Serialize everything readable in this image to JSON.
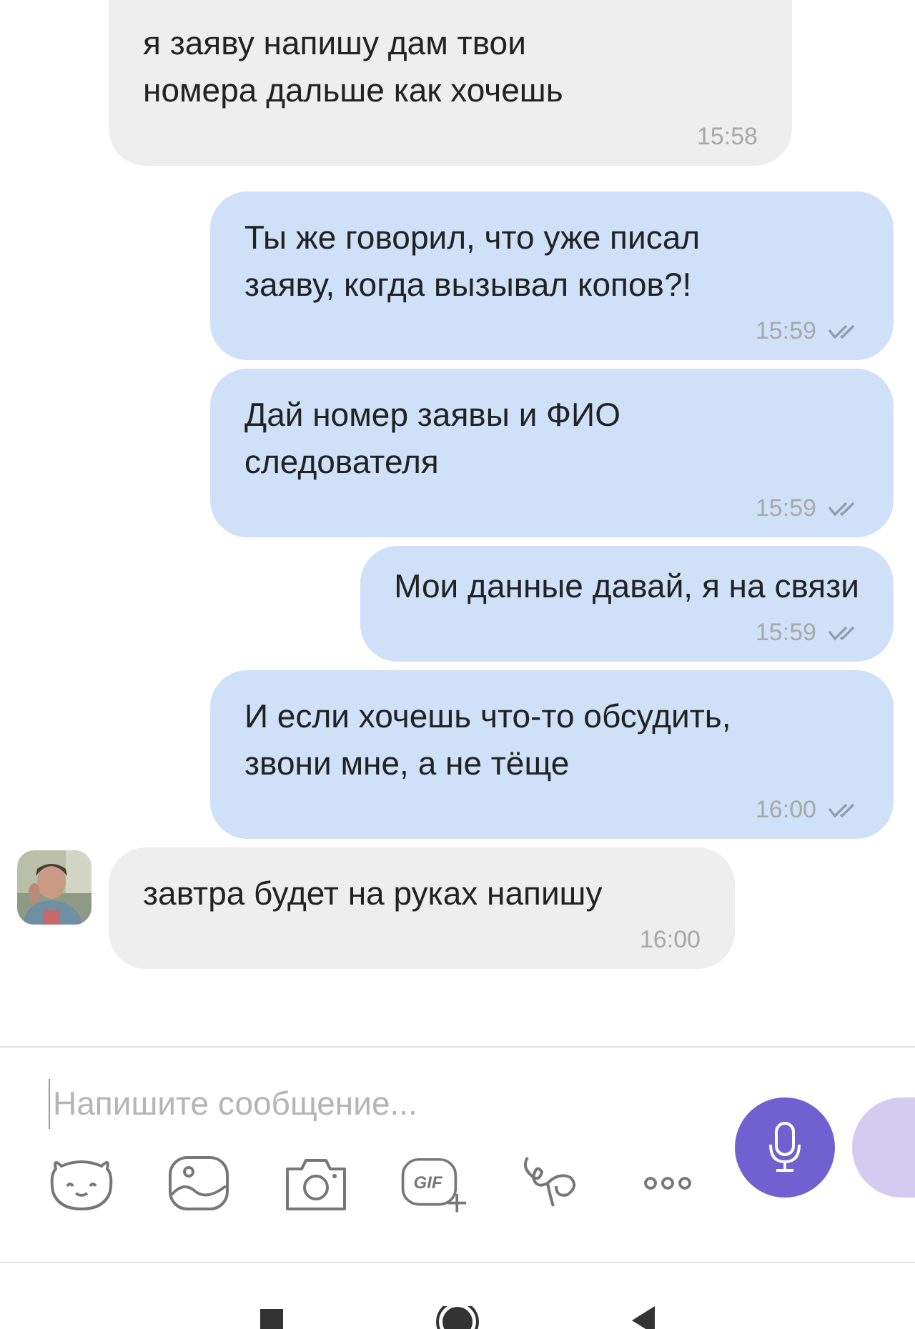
{
  "messages": [
    {
      "kind": "incoming",
      "text": "я заяву напишу дам твои\nномера дальше как хочешь",
      "time": "15:58",
      "avatar": false
    },
    {
      "kind": "outgoing",
      "text": "Ты же говорил, что уже писал\nзаяву, когда вызывал копов?!",
      "time": "15:59",
      "read": true
    },
    {
      "kind": "outgoing",
      "text": "Дай номер заявы и ФИО\nследователя",
      "time": "15:59",
      "read": true
    },
    {
      "kind": "outgoing",
      "text": "Мои данные давай, я на связи",
      "time": "15:59",
      "read": true
    },
    {
      "kind": "outgoing",
      "text": "И если хочешь что-то обсудить,\nзвони мне, а не тёще",
      "time": "16:00",
      "read": true
    },
    {
      "kind": "incoming",
      "text": "завтра будет на руках напишу",
      "time": "16:00",
      "avatar": true
    }
  ],
  "composer": {
    "placeholder": "Напишите сообщение...",
    "tools": [
      {
        "kind": "sticker"
      },
      {
        "kind": "gallery"
      },
      {
        "kind": "camera"
      },
      {
        "kind": "gif",
        "label": "GIF"
      },
      {
        "kind": "doodle"
      },
      {
        "kind": "more"
      }
    ]
  }
}
